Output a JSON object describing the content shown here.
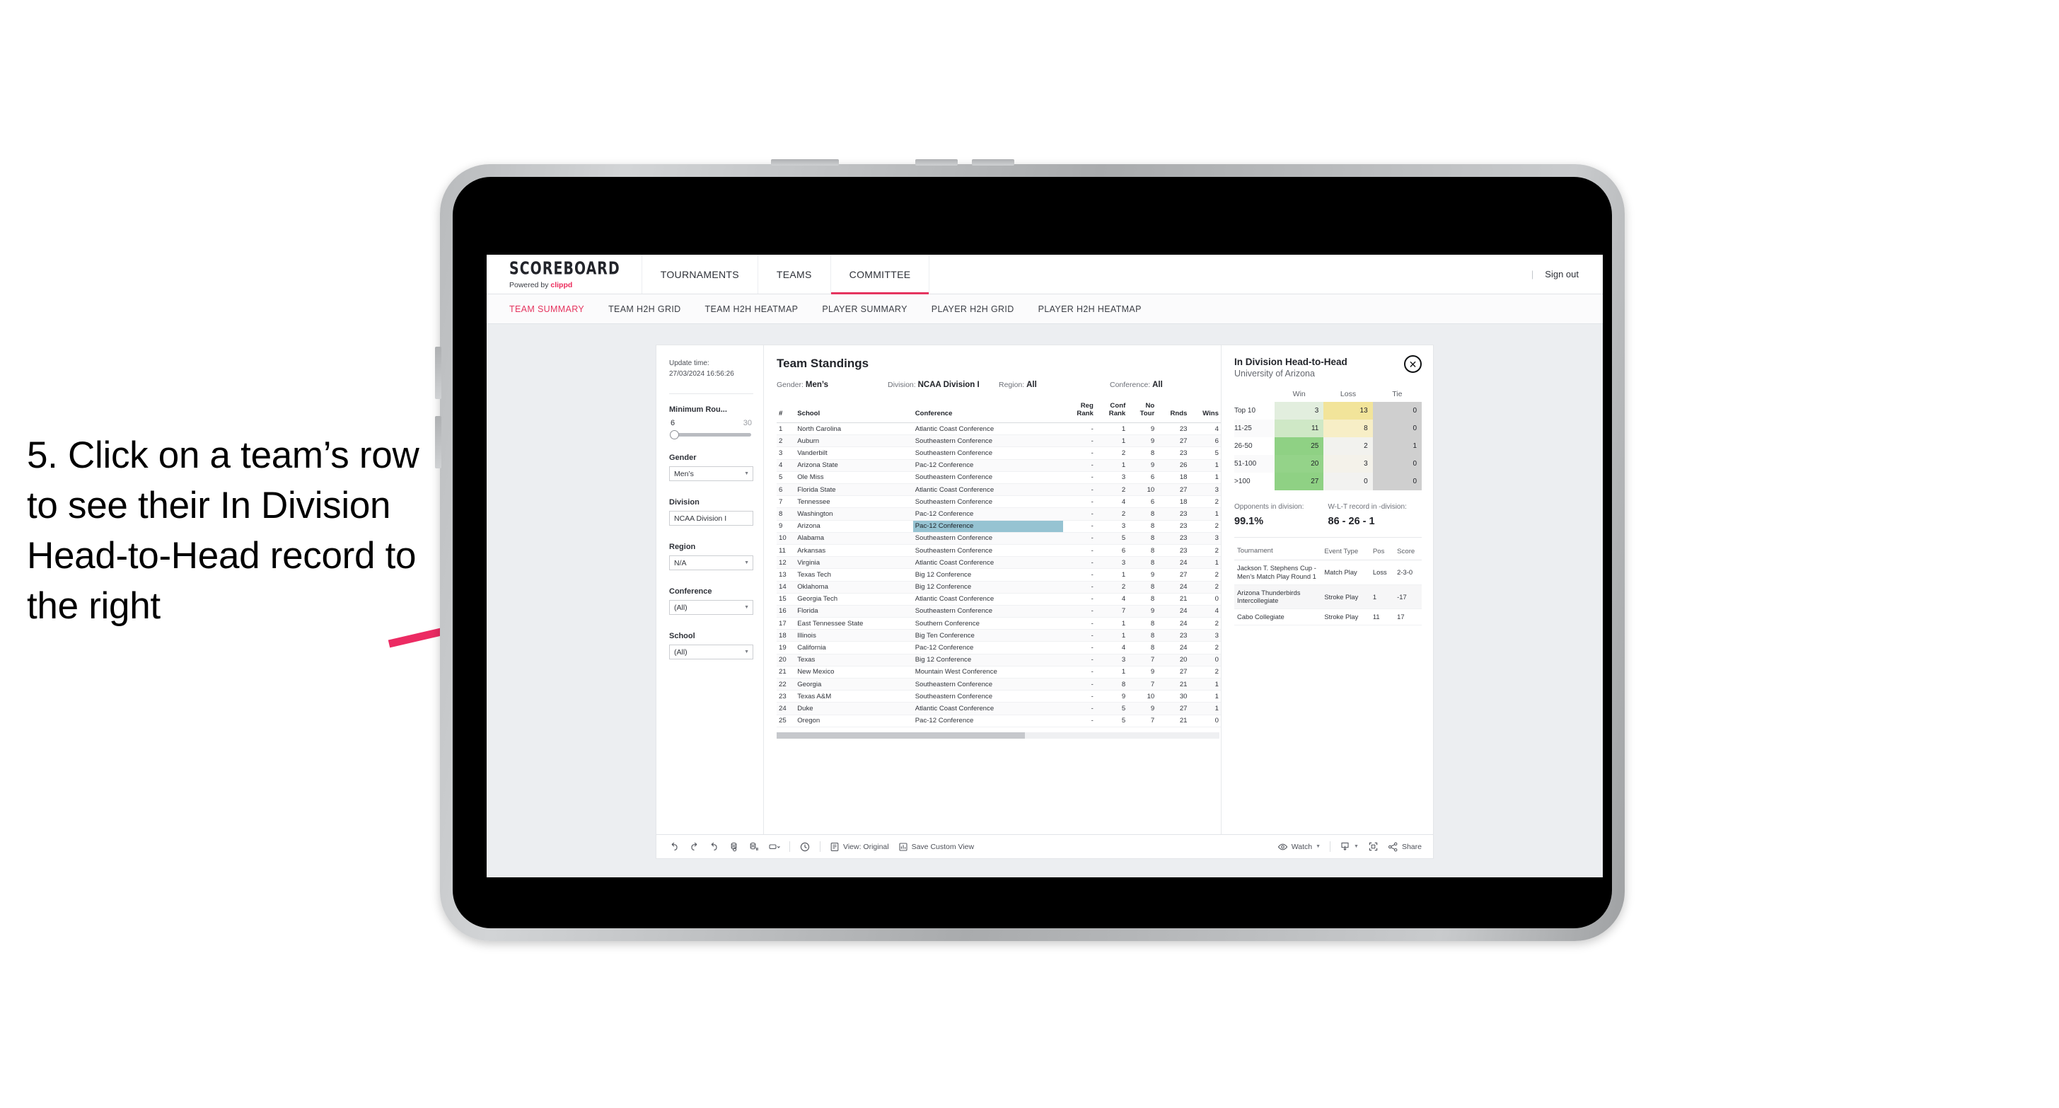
{
  "annotation": {
    "text": "5. Click on a team’s row to see their In Division Head-to-Head record to the right",
    "arrow_color": "#ec2b63"
  },
  "header": {
    "brand_title": "SCOREBOARD",
    "brand_sub_prefix": "Powered by ",
    "brand_sub_name": "clippd",
    "nav": [
      {
        "label": "TOURNAMENTS",
        "active": false
      },
      {
        "label": "TEAMS",
        "active": false
      },
      {
        "label": "COMMITTEE",
        "active": true
      }
    ],
    "divider": "|",
    "sign_out": "Sign out",
    "accent": "#e5355f"
  },
  "sub_tabs": [
    {
      "label": "TEAM SUMMARY",
      "active": true
    },
    {
      "label": "TEAM H2H GRID",
      "active": false
    },
    {
      "label": "TEAM H2H HEATMAP",
      "active": false
    },
    {
      "label": "PLAYER SUMMARY",
      "active": false
    },
    {
      "label": "PLAYER H2H GRID",
      "active": false
    },
    {
      "label": "PLAYER H2H HEATMAP",
      "active": false
    }
  ],
  "filters": {
    "update_time_label": "Update time:",
    "update_time_value": "27/03/2024 16:56:26",
    "min_rounds": {
      "label": "Minimum Rou...",
      "low": "6",
      "high": "30"
    },
    "groups": [
      {
        "label": "Gender",
        "value": "Men’s"
      },
      {
        "label": "Division",
        "value": "NCAA Division I"
      },
      {
        "label": "Region",
        "value": "N/A"
      },
      {
        "label": "Conference",
        "value": "(All)"
      },
      {
        "label": "School",
        "value": "(All)"
      }
    ]
  },
  "standings": {
    "title": "Team Standings",
    "filter_summary": [
      {
        "label": "Gender:",
        "value": "Men’s"
      },
      {
        "label": "Division:",
        "value": "NCAA Division I"
      },
      {
        "label": "Region:",
        "value": "All"
      },
      {
        "label": "Conference:",
        "value": "All"
      }
    ],
    "columns": [
      "#",
      "School",
      "Conference",
      "Reg Rank",
      "Conf Rank",
      "No Tour",
      "Rnds",
      "Wins"
    ],
    "selected_row_index": 8,
    "rows": [
      {
        "rank": "1",
        "school": "North Carolina",
        "conference": "Atlantic Coast Conference",
        "reg_rank": "-",
        "conf_rank": "1",
        "no_tour": "9",
        "rnds": "23",
        "wins": "4"
      },
      {
        "rank": "2",
        "school": "Auburn",
        "conference": "Southeastern Conference",
        "reg_rank": "-",
        "conf_rank": "1",
        "no_tour": "9",
        "rnds": "27",
        "wins": "6"
      },
      {
        "rank": "3",
        "school": "Vanderbilt",
        "conference": "Southeastern Conference",
        "reg_rank": "-",
        "conf_rank": "2",
        "no_tour": "8",
        "rnds": "23",
        "wins": "5"
      },
      {
        "rank": "4",
        "school": "Arizona State",
        "conference": "Pac-12 Conference",
        "reg_rank": "-",
        "conf_rank": "1",
        "no_tour": "9",
        "rnds": "26",
        "wins": "1"
      },
      {
        "rank": "5",
        "school": "Ole Miss",
        "conference": "Southeastern Conference",
        "reg_rank": "-",
        "conf_rank": "3",
        "no_tour": "6",
        "rnds": "18",
        "wins": "1"
      },
      {
        "rank": "6",
        "school": "Florida State",
        "conference": "Atlantic Coast Conference",
        "reg_rank": "-",
        "conf_rank": "2",
        "no_tour": "10",
        "rnds": "27",
        "wins": "3"
      },
      {
        "rank": "7",
        "school": "Tennessee",
        "conference": "Southeastern Conference",
        "reg_rank": "-",
        "conf_rank": "4",
        "no_tour": "6",
        "rnds": "18",
        "wins": "2"
      },
      {
        "rank": "8",
        "school": "Washington",
        "conference": "Pac-12 Conference",
        "reg_rank": "-",
        "conf_rank": "2",
        "no_tour": "8",
        "rnds": "23",
        "wins": "1"
      },
      {
        "rank": "9",
        "school": "Arizona",
        "conference": "Pac-12 Conference",
        "reg_rank": "-",
        "conf_rank": "3",
        "no_tour": "8",
        "rnds": "23",
        "wins": "2"
      },
      {
        "rank": "10",
        "school": "Alabama",
        "conference": "Southeastern Conference",
        "reg_rank": "-",
        "conf_rank": "5",
        "no_tour": "8",
        "rnds": "23",
        "wins": "3"
      },
      {
        "rank": "11",
        "school": "Arkansas",
        "conference": "Southeastern Conference",
        "reg_rank": "-",
        "conf_rank": "6",
        "no_tour": "8",
        "rnds": "23",
        "wins": "2"
      },
      {
        "rank": "12",
        "school": "Virginia",
        "conference": "Atlantic Coast Conference",
        "reg_rank": "-",
        "conf_rank": "3",
        "no_tour": "8",
        "rnds": "24",
        "wins": "1"
      },
      {
        "rank": "13",
        "school": "Texas Tech",
        "conference": "Big 12 Conference",
        "reg_rank": "-",
        "conf_rank": "1",
        "no_tour": "9",
        "rnds": "27",
        "wins": "2"
      },
      {
        "rank": "14",
        "school": "Oklahoma",
        "conference": "Big 12 Conference",
        "reg_rank": "-",
        "conf_rank": "2",
        "no_tour": "8",
        "rnds": "24",
        "wins": "2"
      },
      {
        "rank": "15",
        "school": "Georgia Tech",
        "conference": "Atlantic Coast Conference",
        "reg_rank": "-",
        "conf_rank": "4",
        "no_tour": "8",
        "rnds": "21",
        "wins": "0"
      },
      {
        "rank": "16",
        "school": "Florida",
        "conference": "Southeastern Conference",
        "reg_rank": "-",
        "conf_rank": "7",
        "no_tour": "9",
        "rnds": "24",
        "wins": "4"
      },
      {
        "rank": "17",
        "school": "East Tennessee State",
        "conference": "Southern Conference",
        "reg_rank": "-",
        "conf_rank": "1",
        "no_tour": "8",
        "rnds": "24",
        "wins": "2"
      },
      {
        "rank": "18",
        "school": "Illinois",
        "conference": "Big Ten Conference",
        "reg_rank": "-",
        "conf_rank": "1",
        "no_tour": "8",
        "rnds": "23",
        "wins": "3"
      },
      {
        "rank": "19",
        "school": "California",
        "conference": "Pac-12 Conference",
        "reg_rank": "-",
        "conf_rank": "4",
        "no_tour": "8",
        "rnds": "24",
        "wins": "2"
      },
      {
        "rank": "20",
        "school": "Texas",
        "conference": "Big 12 Conference",
        "reg_rank": "-",
        "conf_rank": "3",
        "no_tour": "7",
        "rnds": "20",
        "wins": "0"
      },
      {
        "rank": "21",
        "school": "New Mexico",
        "conference": "Mountain West Conference",
        "reg_rank": "-",
        "conf_rank": "1",
        "no_tour": "9",
        "rnds": "27",
        "wins": "2"
      },
      {
        "rank": "22",
        "school": "Georgia",
        "conference": "Southeastern Conference",
        "reg_rank": "-",
        "conf_rank": "8",
        "no_tour": "7",
        "rnds": "21",
        "wins": "1"
      },
      {
        "rank": "23",
        "school": "Texas A&M",
        "conference": "Southeastern Conference",
        "reg_rank": "-",
        "conf_rank": "9",
        "no_tour": "10",
        "rnds": "30",
        "wins": "1"
      },
      {
        "rank": "24",
        "school": "Duke",
        "conference": "Atlantic Coast Conference",
        "reg_rank": "-",
        "conf_rank": "5",
        "no_tour": "9",
        "rnds": "27",
        "wins": "1"
      },
      {
        "rank": "25",
        "school": "Oregon",
        "conference": "Pac-12 Conference",
        "reg_rank": "-",
        "conf_rank": "5",
        "no_tour": "7",
        "rnds": "21",
        "wins": "0"
      }
    ]
  },
  "h2h": {
    "title": "In Division Head-to-Head",
    "subtitle": "University of Arizona",
    "close_icon": "✕",
    "opponents_label": "Opponents in division:",
    "opponents_value": "99.1%",
    "record_label": "W-L-T record in -division:",
    "record_value": "86 - 26 - 1",
    "tournament_columns": [
      "Tournament",
      "Event Type",
      "Pos",
      "Score"
    ],
    "tournaments": [
      {
        "name": "Jackson T. Stephens Cup - Men’s Match Play Round 1",
        "event_type": "Match Play",
        "pos": "Loss",
        "score": "2-3-0"
      },
      {
        "name": "Arizona Thunderbirds Intercollegiate",
        "event_type": "Stroke Play",
        "pos": "1",
        "score": "-17"
      },
      {
        "name": "Cabo Collegiate",
        "event_type": "Stroke Play",
        "pos": "11",
        "score": "17"
      }
    ]
  },
  "chart_data": {
    "type": "heatmap",
    "title": "In Division Head-to-Head",
    "subtitle": "University of Arizona",
    "xlabel": "",
    "ylabel": "",
    "columns": [
      "Win",
      "Loss",
      "Tie"
    ],
    "categories": [
      "Top 10",
      "11-25",
      "26-50",
      "51-100",
      ">100"
    ],
    "series": [
      {
        "name": "Win",
        "values": [
          3,
          11,
          25,
          20,
          27
        ]
      },
      {
        "name": "Loss",
        "values": [
          13,
          8,
          2,
          3,
          0
        ]
      },
      {
        "name": "Tie",
        "values": [
          0,
          0,
          1,
          0,
          0
        ]
      }
    ],
    "cell_colors": {
      "win": [
        "#e2eede",
        "#cfe8c6",
        "#8fd184",
        "#94d389",
        "#8fd184"
      ],
      "loss": [
        "#f2e49a",
        "#f7eec6",
        "#f2f2ee",
        "#f4f2ea",
        "#f2f2f0"
      ],
      "tie": [
        "#cfcfcf",
        "#cfcfcf",
        "#cfcfcf",
        "#cfcfcf",
        "#cfcfcf"
      ]
    }
  },
  "toolbar": {
    "view_label": "View: Original",
    "save_label": "Save Custom View",
    "watch_label": "Watch",
    "share_label": "Share"
  }
}
